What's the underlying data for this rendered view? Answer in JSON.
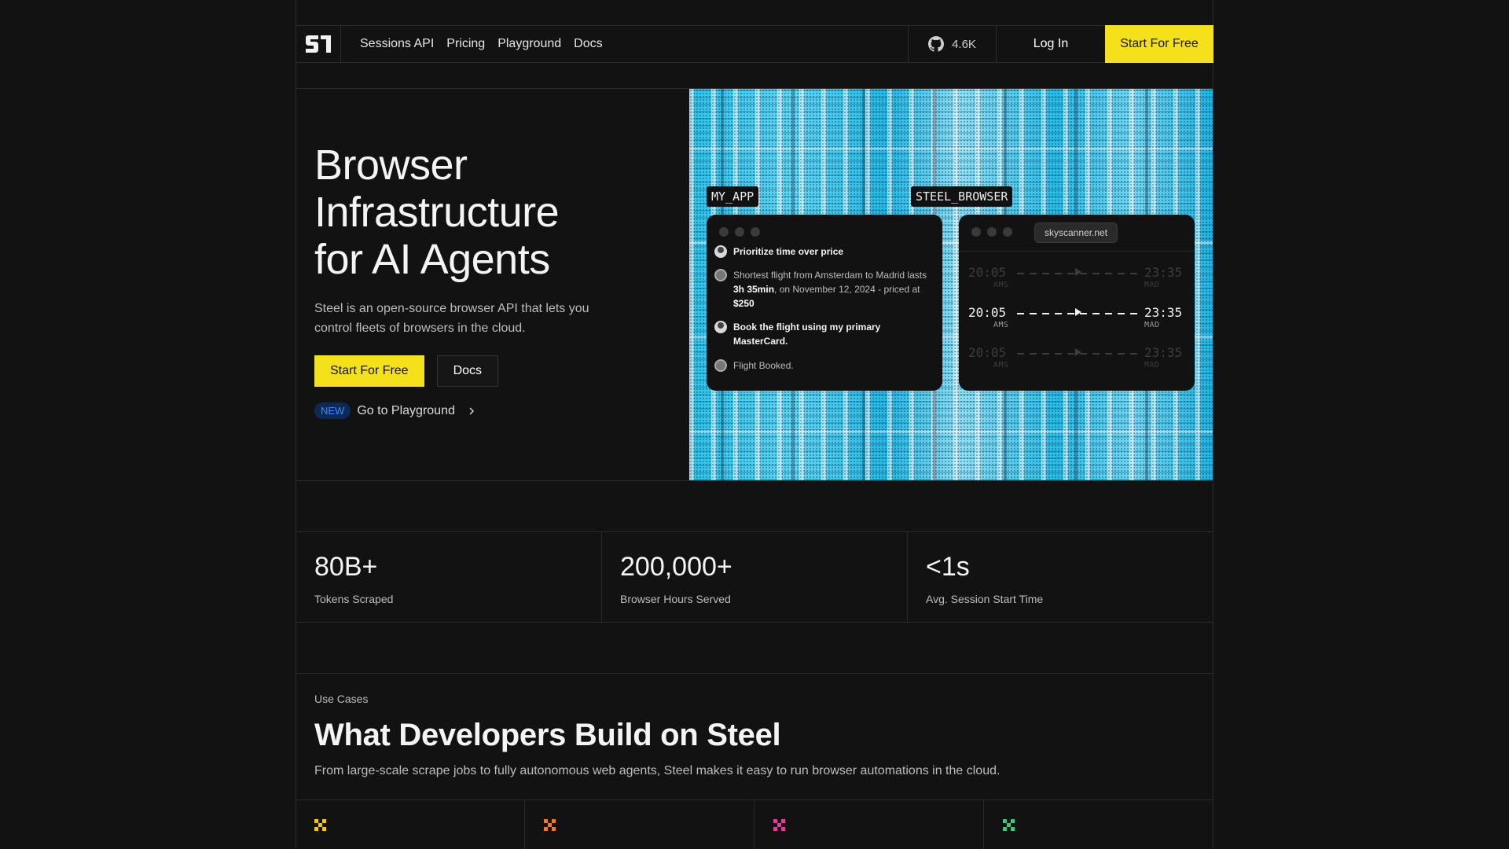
{
  "nav": {
    "links": [
      "Sessions API",
      "Pricing",
      "Playground",
      "Docs"
    ],
    "github_stars": "4.6K",
    "login": "Log In",
    "cta": "Start For Free"
  },
  "hero": {
    "title_lines": [
      "Browser",
      "Infrastructure",
      "for AI Agents"
    ],
    "subtitle": "Steel is an open-source browser API that lets you control fleets of browsers in the cloud.",
    "primary_button": "Start For Free",
    "secondary_button": "Docs",
    "badge": "NEW",
    "playground_link": "Go to Playground"
  },
  "demo": {
    "app_tag": "MY_APP",
    "browser_tag": "STEEL_BROWSER",
    "messages": [
      {
        "role": "user",
        "text": "Prioritize time over price"
      },
      {
        "role": "bot",
        "pre": "Shortest flight from Amsterdam to Madrid lasts ",
        "b1": "3h 35min",
        "mid": ", on November 12, 2024 - priced at ",
        "b2": "$250"
      },
      {
        "role": "user",
        "text": "Book the flight using my primary MasterCard."
      },
      {
        "role": "bot",
        "text": "Flight Booked."
      }
    ],
    "url": "skyscanner.net",
    "flights": [
      {
        "dep": "20:05",
        "from": "AMS",
        "arr": "23:35",
        "to": "MAD"
      },
      {
        "dep": "20:05",
        "from": "AMS",
        "arr": "23:35",
        "to": "MAD"
      },
      {
        "dep": "20:05",
        "from": "AMS",
        "arr": "23:35",
        "to": "MAD"
      }
    ]
  },
  "stats": [
    {
      "value": "80B+",
      "label": "Tokens Scraped"
    },
    {
      "value": "200,000+",
      "label": "Browser Hours Served"
    },
    {
      "value": "<1s",
      "label": "Avg. Session Start Time"
    }
  ],
  "use_cases": {
    "kicker": "Use Cases",
    "title": "What Developers Build on Steel",
    "subtitle": "From large-scale scrape jobs to fully autonomous web agents, Steel makes it easy to run browser automations in the cloud.",
    "icon_colors": [
      "#f5c518",
      "#f07a2a",
      "#e83aa0",
      "#3ec97a"
    ]
  }
}
